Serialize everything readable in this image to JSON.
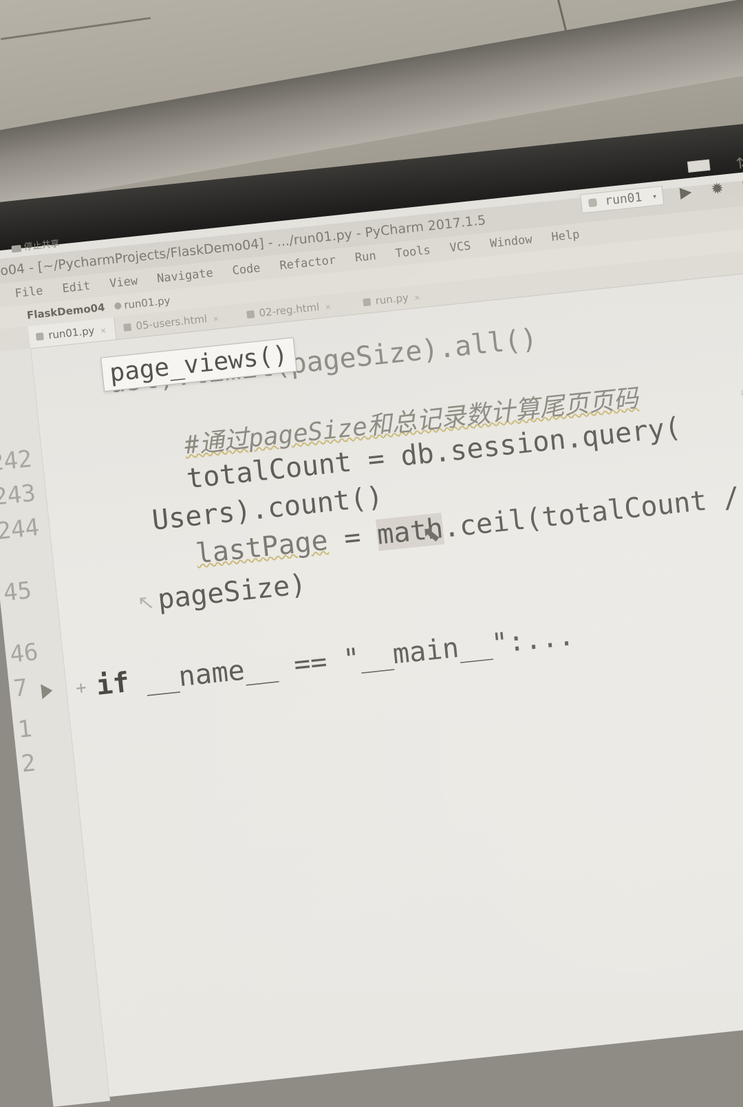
{
  "window": {
    "title": "emo04 - [~/PycharmProjects/FlaskDemo04] - .../run01.py - PyCharm 2017.1.5",
    "share_label": "停止共享"
  },
  "toolbar": {
    "run_config": "run01"
  },
  "menu": [
    "File",
    "Edit",
    "View",
    "Navigate",
    "Code",
    "Refactor",
    "Run",
    "Tools",
    "VCS",
    "Window",
    "Help"
  ],
  "navbar": {
    "project": "FlaskDemo04",
    "file": "run01.py"
  },
  "tabs": [
    {
      "label": "run01.py",
      "active": true
    },
    {
      "label": "05-users.html",
      "active": false
    },
    {
      "label": "02-reg.html",
      "active": false
    },
    {
      "label": "run.py",
      "active": false
    }
  ],
  "editor": {
    "popup": "page_views()",
    "line_numbers": [
      "242",
      "243",
      "244",
      "45",
      "46",
      "7",
      "1",
      "2"
    ],
    "lines": {
      "partial_top": "ust).limit(pageSize).all()",
      "comment": "#通过pageSize和总记录数计算尾页页码",
      "l243_a": "totalCount = db.session.query(",
      "l243_b": "Users).count()",
      "l244_a_var": "lastPage",
      "l244_a_eq": " = ",
      "l244_a_math": "math",
      "l244_a_rest": ".ceil(totalCount /",
      "l244_b": "pageSize)",
      "main_if": "if",
      "main_rest": " __name__ == \"__main__\":..."
    }
  }
}
